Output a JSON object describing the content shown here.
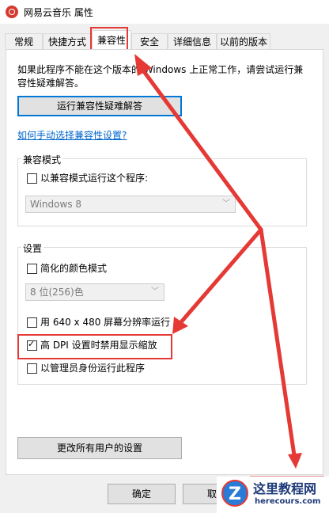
{
  "window": {
    "title": "网易云音乐 属性"
  },
  "tabs": [
    {
      "label": "常规"
    },
    {
      "label": "快捷方式"
    },
    {
      "label": "兼容性"
    },
    {
      "label": "安全"
    },
    {
      "label": "详细信息"
    },
    {
      "label": "以前的版本"
    }
  ],
  "active_tab": "兼容性",
  "description_line1": "如果此程序不能在这个版本的 Windows 上正常工作，请尝试运行兼",
  "description_line2": "容性疑难解答。",
  "run_troubleshooter_button": "运行兼容性疑难解答",
  "manual_link": "如何手动选择兼容性设置?",
  "compat_mode": {
    "label": "兼容模式",
    "checkbox_label": "以兼容模式运行这个程序:",
    "checked": false,
    "select_value": "Windows 8"
  },
  "settings": {
    "label": "设置",
    "reduced_color": {
      "label": "简化的颜色模式",
      "checked": false
    },
    "color_select_value": "8 位(256)色",
    "res_640": {
      "label": "用 640 x 480 屏幕分辨率运行",
      "checked": false
    },
    "high_dpi": {
      "label": "高 DPI 设置时禁用显示缩放",
      "checked": true
    },
    "run_admin": {
      "label": "以管理员身份运行此程序",
      "checked": false
    }
  },
  "change_all_users_button": "更改所有用户的设置",
  "ok_button": "确定",
  "cancel_button": "取",
  "watermark": {
    "logo_letter": "Z",
    "title": "这里教程网",
    "url": "herecours.com"
  },
  "colors": {
    "accent_blue": "#0078d7",
    "highlight_red": "#e53935",
    "link": "#0066cc"
  }
}
